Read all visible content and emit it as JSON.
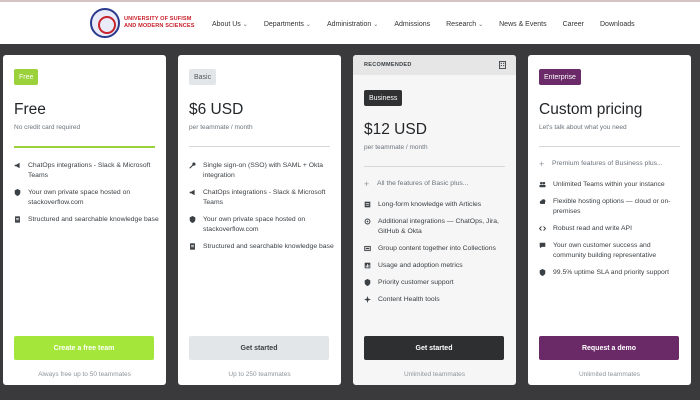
{
  "nav": {
    "logo_line1": "UNIVERSITY OF SUFISM",
    "logo_line2": "AND MODERN SCIENCES",
    "items": [
      {
        "label": "About Us",
        "dropdown": true
      },
      {
        "label": "Departments",
        "dropdown": true
      },
      {
        "label": "Administration",
        "dropdown": true
      },
      {
        "label": "Admissions",
        "dropdown": false
      },
      {
        "label": "Research",
        "dropdown": true
      },
      {
        "label": "News & Events",
        "dropdown": false
      },
      {
        "label": "Career",
        "dropdown": false
      },
      {
        "label": "Downloads",
        "dropdown": false
      }
    ]
  },
  "plans": {
    "free": {
      "badge": "Free",
      "title": "Free",
      "subtitle": "No credit card required",
      "features": [
        "ChatOps integrations - Slack & Microsoft Teams",
        "Your own private space hosted on stackoverflow.com",
        "Structured and searchable knowledge base"
      ],
      "cta": "Create a free team",
      "footnote": "Always free up to 50 teammates"
    },
    "basic": {
      "badge": "Basic",
      "price": "$6 USD",
      "price_sub": "per teammate / month",
      "features": [
        "Single sign-on (SSO) with SAML + Okta integration",
        "ChatOps integrations - Slack & Microsoft Teams",
        "Your own private space hosted on stackoverflow.com",
        "Structured and searchable knowledge base"
      ],
      "cta": "Get started",
      "footnote": "Up to 250 teammates"
    },
    "business": {
      "recommended": "RECOMMENDED",
      "badge": "Business",
      "price": "$12 USD",
      "price_sub": "per teammate / month",
      "intro": "All the features of Basic plus...",
      "features": [
        "Long-form knowledge with Articles",
        "Additional integrations — ChatOps, Jira, GitHub & Okta",
        "Group content together into Collections",
        "Usage and adoption metrics",
        "Priority customer support",
        "Content Health tools"
      ],
      "cta": "Get started",
      "footnote": "Unlimited teammates"
    },
    "enterprise": {
      "badge": "Enterprise",
      "title": "Custom pricing",
      "subtitle": "Let's talk about what you need",
      "intro": "Premium features of Business plus...",
      "features": [
        "Unlimited Teams within your instance",
        "Flexible hosting options — cloud or on-premises",
        "Robust read and write API",
        "Your own customer success and community building representative",
        "99.5% uptime SLA and priority support"
      ],
      "cta": "Request a demo",
      "footnote": "Unlimited teammates"
    }
  },
  "colors": {
    "free_accent": "#a5e63a",
    "enterprise_accent": "#6a2a67",
    "business_dark": "#2d2f31",
    "page_bg": "#3a3a3c"
  }
}
